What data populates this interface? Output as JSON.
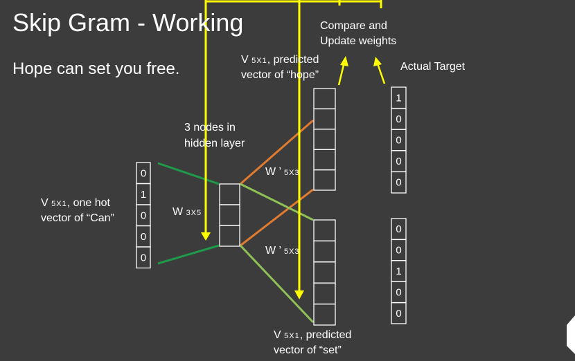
{
  "slide": {
    "title": "Skip Gram - Working",
    "subtitle": "Hope can set you free."
  },
  "labels": {
    "compare": [
      "Compare and",
      "Update weights"
    ],
    "actual_target": "Actual Target",
    "predicted_hope": {
      "v": "V",
      "dims": "5X1",
      "line1_rest": ", predicted",
      "line2": "vector of “hope”"
    },
    "hidden_layer": [
      "3 nodes in",
      "hidden layer"
    ],
    "input_vector": {
      "v": "V",
      "dims": "5X1",
      "line1_rest": ", one hot",
      "line2": "vector of “Can”"
    },
    "w_input": {
      "w": "W",
      "dims": "3X5"
    },
    "w_output_top": {
      "w": "W ’",
      "dims": "5X3"
    },
    "w_output_bottom": {
      "w": "W ’",
      "dims": "5X3"
    },
    "predicted_set": {
      "v": "V",
      "dims": "5X1",
      "line1_rest": ", predicted",
      "line2": "vector of “set”"
    }
  },
  "vectors": {
    "input": [
      "0",
      "1",
      "0",
      "0",
      "0"
    ],
    "target_hope": [
      "1",
      "0",
      "0",
      "0",
      "0"
    ],
    "target_set": [
      "0",
      "0",
      "1",
      "0",
      "0"
    ],
    "hidden_count": 3,
    "predicted_count": 5
  },
  "colors": {
    "background": "#3c3c3c",
    "input_edges": "#1e9a4a",
    "output_edges_orange": "#e07b30",
    "output_edges_lightgreen": "#8fc156",
    "highlight_arrows": "#ffff00",
    "cell_border": "#ffffff"
  }
}
